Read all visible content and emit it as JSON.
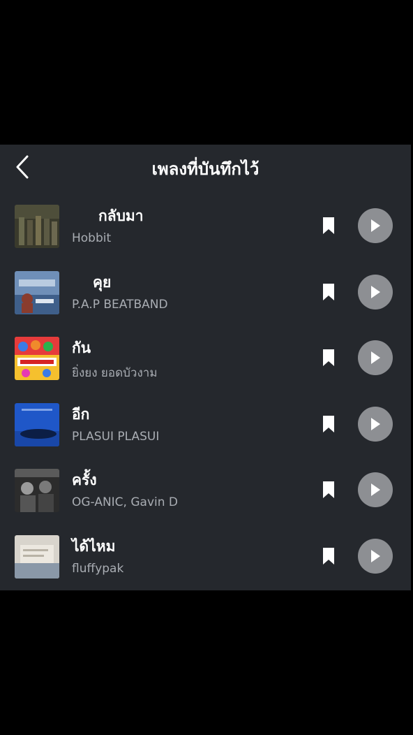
{
  "header": {
    "title": "เพลงที่บันทึกไว้",
    "back_icon": "chevron-left-icon"
  },
  "songs": [
    {
      "title": "กลับมา",
      "artist": "Hobbit",
      "art_colors": [
        "#3a3a2c",
        "#6a6a4e"
      ]
    },
    {
      "title": "คุย",
      "artist": "P.A.P BEATBAND",
      "art_colors": [
        "#6f8fb8",
        "#8a3c2e"
      ]
    },
    {
      "title": "กัน",
      "artist": "ยิ่งยง ยอดบัวงาม",
      "art_colors": [
        "#e63b3b",
        "#f5c02e"
      ]
    },
    {
      "title": "อีก",
      "artist": "PLASUI PLASUI",
      "art_colors": [
        "#1f57c8",
        "#0c1e45"
      ]
    },
    {
      "title": "ครั้ง",
      "artist": "OG-ANIC, Gavin D",
      "art_colors": [
        "#2c2c2c",
        "#9a9a9a"
      ]
    },
    {
      "title": "ได้ไหม",
      "artist": "fluffypak",
      "art_colors": [
        "#d8d4cc",
        "#8a98a8"
      ]
    }
  ],
  "colors": {
    "panel": "#25282d",
    "play_button": "#8d8f93",
    "artist_text": "#a9adb3"
  },
  "icons": {
    "bookmark": "bookmark-icon",
    "play": "play-icon"
  }
}
